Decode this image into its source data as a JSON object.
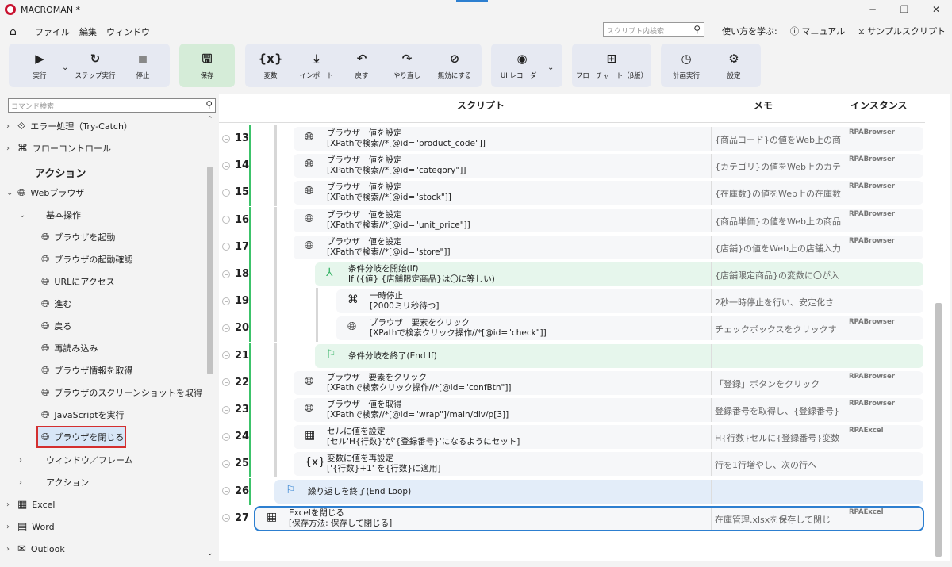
{
  "app": {
    "title": "MACROMAN *"
  },
  "menu": {
    "file": "ファイル",
    "edit": "編集",
    "window": "ウィンドウ"
  },
  "top_search": {
    "placeholder": "スクリプト内検索"
  },
  "help": {
    "learn": "使い方を学ぶ:",
    "manual": "マニュアル",
    "sample": "サンプルスクリプト"
  },
  "ribbon": {
    "run": "実行",
    "step": "ステップ実行",
    "stop": "停止",
    "save": "保存",
    "variable": "変数",
    "import": "インポート",
    "undo": "戻す",
    "redo": "やり直し",
    "disable": "無効にする",
    "ui_recorder": "UI レコーダー",
    "flowchart": "フローチャート（β版）",
    "schedule": "計画実行",
    "settings": "設定"
  },
  "left": {
    "search_placeholder": "コマンド検索",
    "items": [
      "エラー処理（Try-Catch）",
      "フローコントロール",
      "アクション",
      "Webブラウザ",
      "基本操作",
      "ブラウザを起動",
      "ブラウザの起動確認",
      "URLにアクセス",
      "進む",
      "戻る",
      "再読み込み",
      "ブラウザ情報を取得",
      "ブラウザのスクリーンショットを取得",
      "JavaScriptを実行",
      "ブラウザを閉じる",
      "ウィンドウ／フレーム",
      "アクション",
      "Excel",
      "Word",
      "Outlook"
    ]
  },
  "columns": {
    "script": "スクリプト",
    "memo": "メモ",
    "instance": "インスタンス"
  },
  "rows": [
    {
      "n": "13",
      "t1": "ブラウザ　値を設定",
      "t2": "[XPathで検索//*[@id=\"product_code\"]]",
      "memo": "{商品コード}の値をWeb上の商",
      "inst": "RPABrowser"
    },
    {
      "n": "14",
      "t1": "ブラウザ　値を設定",
      "t2": "[XPathで検索//*[@id=\"category\"]]",
      "memo": "{カテゴリ}の値をWeb上のカテ",
      "inst": "RPABrowser"
    },
    {
      "n": "15",
      "t1": "ブラウザ　値を設定",
      "t2": "[XPathで検索//*[@id=\"stock\"]]",
      "memo": "{在庫数}の値をWeb上の在庫数",
      "inst": "RPABrowser"
    },
    {
      "n": "16",
      "t1": "ブラウザ　値を設定",
      "t2": "[XPathで検索//*[@id=\"unit_price\"]]",
      "memo": "{商品単価}の値をWeb上の商品",
      "inst": "RPABrowser"
    },
    {
      "n": "17",
      "t1": "ブラウザ　値を設定",
      "t2": "[XPathで検索//*[@id=\"store\"]]",
      "memo": "{店舗}の値をWeb上の店舗入力",
      "inst": "RPABrowser"
    },
    {
      "n": "18",
      "t1": "条件分岐を開始(If)",
      "t2": "If ({値} {店舗限定商品}は〇に等しい)",
      "memo": "{店舗限定商品}の変数に〇が入",
      "inst": ""
    },
    {
      "n": "19",
      "t1": "一時停止",
      "t2": "[2000ミリ秒待つ]",
      "memo": "2秒一時停止を行い、安定化さ",
      "inst": ""
    },
    {
      "n": "20",
      "t1": "ブラウザ　要素をクリック",
      "t2": "[XPathで検索クリック操作//*[@id=\"check\"]]",
      "memo": "チェックボックスをクリックす",
      "inst": "RPABrowser"
    },
    {
      "n": "21",
      "t1": "条件分岐を終了(End If)",
      "t2": "",
      "memo": "",
      "inst": ""
    },
    {
      "n": "22",
      "t1": "ブラウザ　要素をクリック",
      "t2": "[XPathで検索クリック操作//*[@id=\"confBtn\"]]",
      "memo": "「登録」ボタンをクリック",
      "inst": "RPABrowser"
    },
    {
      "n": "23",
      "t1": "ブラウザ　値を取得",
      "t2": "[XPathで検索//*[@id=\"wrap\"]/main/div/p[3]]",
      "memo": "登録番号を取得し、{登録番号}",
      "inst": "RPABrowser"
    },
    {
      "n": "24",
      "t1": "セルに値を設定",
      "t2": "[セル'H{行数}'が'{登録番号}'になるようにセット]",
      "memo": "H{行数}セルに{登録番号}変数",
      "inst": "RPAExcel"
    },
    {
      "n": "25",
      "t1": "変数に値を再設定",
      "t2": "['{行数}+1' を{行数}に適用]",
      "memo": "行を1行増やし、次の行へ",
      "inst": ""
    },
    {
      "n": "26",
      "t1": "繰り返しを終了(End Loop)",
      "t2": "",
      "memo": "",
      "inst": ""
    },
    {
      "n": "27",
      "t1": "Excelを閉じる",
      "t2": "[保存方法: 保存して閉じる]",
      "memo": "在庫管理.xlsxを保存して閉じ",
      "inst": "RPAExcel"
    }
  ]
}
